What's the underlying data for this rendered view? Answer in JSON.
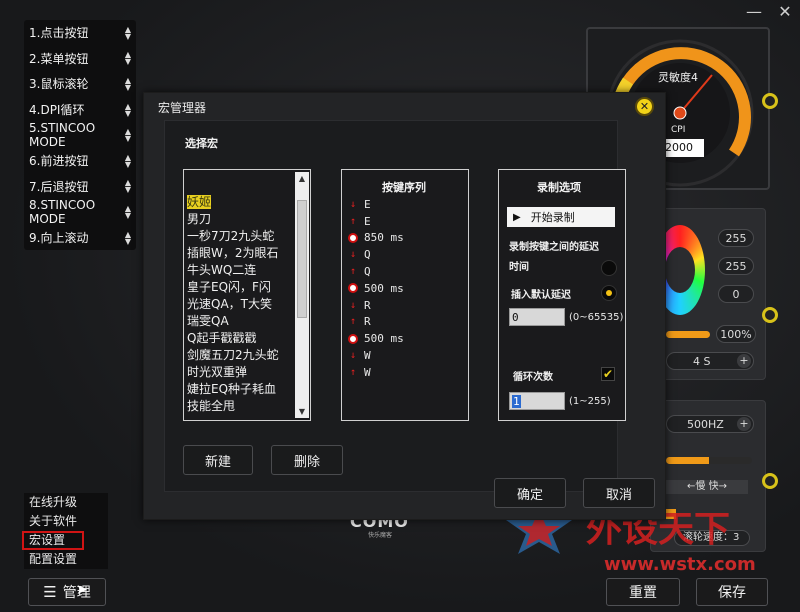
{
  "window": {
    "minimize": "—",
    "close": "✕"
  },
  "button_list": [
    {
      "label": "1.点击按钮"
    },
    {
      "label": "2.菜单按钮"
    },
    {
      "label": "3.鼠标滚轮"
    },
    {
      "label": "4.DPI循环"
    },
    {
      "label": "5.STINCOO MODE"
    },
    {
      "label": "6.前进按钮"
    },
    {
      "label": "7.后退按钮"
    },
    {
      "label": "8.STINCOO MODE"
    },
    {
      "label": "9.向上滚动"
    }
  ],
  "gauge": {
    "label": "灵敏度4",
    "unit": "CPI",
    "value": "2000"
  },
  "rgb_panel": {
    "r": "255",
    "g": "255",
    "b": "0",
    "brightness": "100%",
    "speed": "4 S",
    "plus": "+"
  },
  "report_panel": {
    "rate": "500HZ",
    "plus": "+",
    "slow_fast": "←慢   快→",
    "scroll_speed_label": "滚轮速度：",
    "scroll_speed_value": "3"
  },
  "brand_logo": "COMO",
  "brand_sub": "快乐魔客",
  "side_menu": [
    {
      "label": "在线升级"
    },
    {
      "label": "关于软件"
    },
    {
      "label": "宏设置"
    },
    {
      "label": "配置设置"
    }
  ],
  "bottom": {
    "manage": "管理",
    "reset": "重置",
    "save": "保存"
  },
  "macro_dialog": {
    "title": "宏管理器",
    "close": "✕",
    "select_label": "选择宏",
    "macros": [
      "妖姬",
      "男刀",
      "一秒7刀2九头蛇",
      "插眼W，2为眼石",
      "牛头WQ二连",
      "皇子EQ闪，F闪",
      "光速QA，T大笑",
      "瑞雯QA",
      "Q起手戳戳戳",
      "剑魔五刀2九头蛇",
      "时光双重弹",
      "婕拉EQ种子耗血",
      "技能全甩"
    ],
    "sequence_label": "按键序列",
    "sequence": [
      {
        "type": "down",
        "text": "E"
      },
      {
        "type": "up",
        "text": "E"
      },
      {
        "type": "delay",
        "text": "850 ms"
      },
      {
        "type": "down",
        "text": "Q"
      },
      {
        "type": "up",
        "text": "Q"
      },
      {
        "type": "delay",
        "text": "500 ms"
      },
      {
        "type": "down",
        "text": "R"
      },
      {
        "type": "up",
        "text": "R"
      },
      {
        "type": "delay",
        "text": "500 ms"
      },
      {
        "type": "down",
        "text": "W"
      },
      {
        "type": "up",
        "text": "W"
      }
    ],
    "record_label": "录制选项",
    "start_record": "开始录制",
    "record_delay_line1": "录制按键之间的延迟",
    "record_delay_line2": "时间",
    "insert_default_delay": "插入默认延迟",
    "delay_value": "0",
    "delay_range": "(0~65535)",
    "loop_label": "循环次数",
    "loop_value": "1",
    "loop_range": "(1~255)",
    "new_button": "新建",
    "delete_button": "删除",
    "ok_button": "确定",
    "cancel_button": "取消"
  },
  "watermark": {
    "cn": "外设天下",
    "url": "www.wstx.com"
  }
}
